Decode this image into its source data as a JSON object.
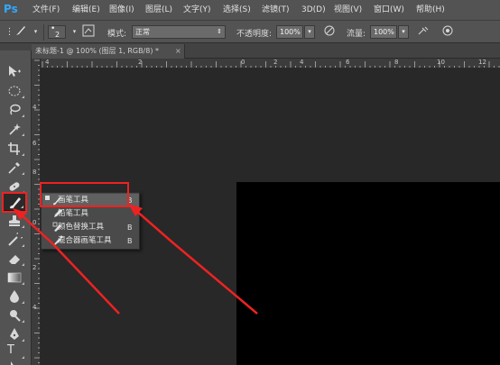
{
  "app": {
    "logo": "Ps",
    "menu": [
      "文件(F)",
      "编辑(E)",
      "图像(I)",
      "图层(L)",
      "文字(Y)",
      "选择(S)",
      "滤镜(T)",
      "3D(D)",
      "视图(V)",
      "窗口(W)",
      "帮助(H)"
    ]
  },
  "options": {
    "tool_icon": "brush-icon",
    "brush_size": "2",
    "mode_label": "模式:",
    "mode_value": "正常",
    "opacity_label": "不透明度:",
    "opacity_value": "100%",
    "flow_label": "流量:",
    "flow_value": "100%"
  },
  "document": {
    "tab_title": "未标题-1 @ 100% (图层 1, RGB/8) *",
    "close_glyph": "×",
    "canvas_color": "#000000"
  },
  "rulers": {
    "top_labels": [
      "4",
      "2",
      "0",
      "2",
      "4",
      "6",
      "8",
      "10",
      "12"
    ],
    "left_labels": [
      "4",
      "6",
      "8",
      "0",
      "2",
      "4"
    ]
  },
  "toolbox": {
    "tools": [
      "move-tool-icon",
      "marquee-tool-icon",
      "lasso-tool-icon",
      "magic-wand-tool-icon",
      "crop-tool-icon",
      "eyedropper-tool-icon",
      "healing-brush-tool-icon",
      "brush-tool-icon",
      "stamp-tool-icon",
      "history-brush-tool-icon",
      "eraser-tool-icon",
      "gradient-tool-icon",
      "blur-tool-icon",
      "dodge-tool-icon",
      "pen-tool-icon",
      "type-tool-icon",
      "path-select-tool-icon"
    ],
    "type_glyph": "T"
  },
  "flyout": {
    "items": [
      {
        "label": "画笔工具",
        "key": "B",
        "selected": true
      },
      {
        "label": "铅笔工具",
        "key": "",
        "selected": false
      },
      {
        "label": "颜色替换工具",
        "key": "B",
        "selected": false
      },
      {
        "label": "混合器画笔工具",
        "key": "B",
        "selected": false
      }
    ]
  },
  "annotation": {
    "color": "#ee2222"
  }
}
